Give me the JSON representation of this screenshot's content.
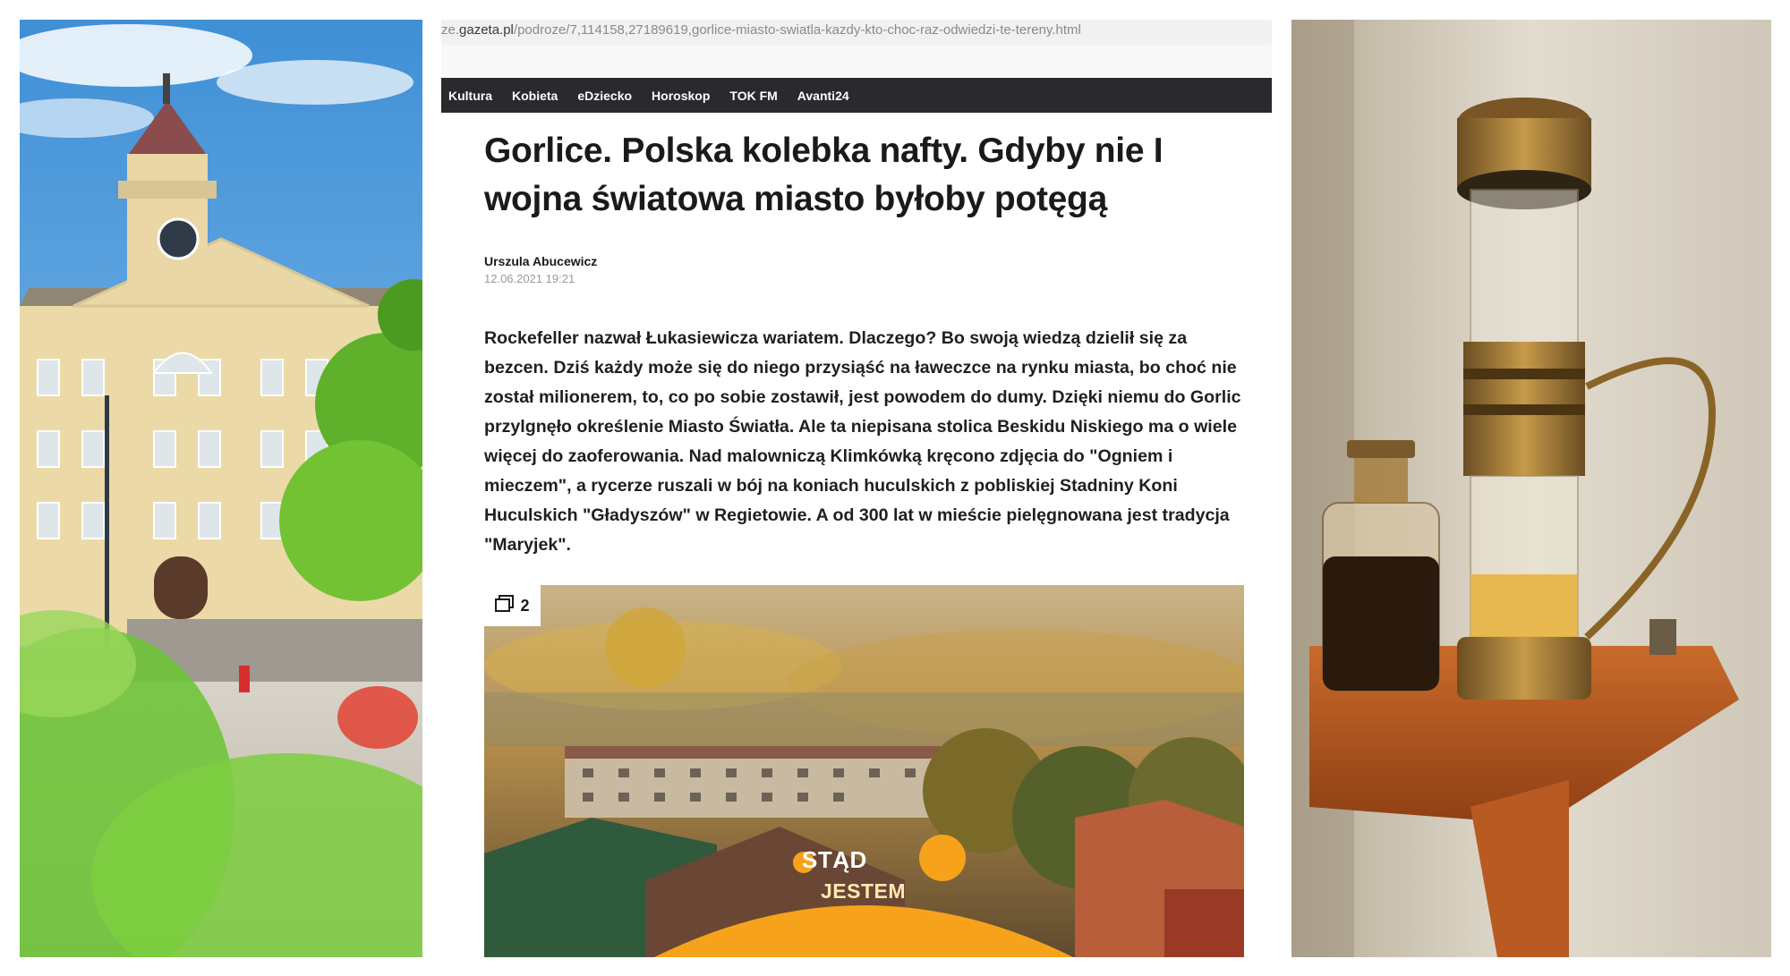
{
  "browser": {
    "url_prefix": "ze.",
    "url_domain": "gazeta.pl",
    "url_path": "/podroze/7,114158,27189619,gorlice-miasto-swiatla-kazdy-kto-choc-raz-odwiedzi-te-tereny.html"
  },
  "nav": {
    "items": [
      "Kultura",
      "Kobieta",
      "eDziecko",
      "Horoskop",
      "TOK FM",
      "Avanti24"
    ]
  },
  "article": {
    "title": "Gorlice. Polska kolebka nafty. Gdyby nie I wojna światowa miasto byłoby potęgą",
    "author": "Urszula Abucewicz",
    "date": "12.06.2021 19:21",
    "lead": "Rockefeller nazwał Łukasiewicza wariatem. Dlaczego? Bo swoją wiedzą dzielił się za bezcen. Dziś każdy może się do niego przysiąść na ławeczce na rynku miasta, bo choć nie został milionerem, to, co po sobie zostawił, jest powodem do dumy. Dzięki niemu do Gorlic przylgnęło określenie Miasto Światła. Ale ta niepisana stolica Beskidu Niskiego ma o wiele więcej do zaoferowania. Nad malowniczą Klimkówką kręcono zdjęcia do \"Ogniem i mieczem\", a rycerze ruszali w bój na koniach huculskich z pobliskiej Stadniny Koni Huculskich \"Gładyszów\" w Regietowie. A od 300 lat w mieście pielęgnowana jest tradycja \"Maryjek\"."
  },
  "image": {
    "gallery_count": "2",
    "gallery_icon": "gallery-icon",
    "overlay_line1": "STĄD",
    "overlay_line2": "JESTEM"
  },
  "colors": {
    "nav_bg": "#2a2a2e",
    "overlay_orange": "#f7a21b",
    "headline": "#1a1a1a"
  }
}
